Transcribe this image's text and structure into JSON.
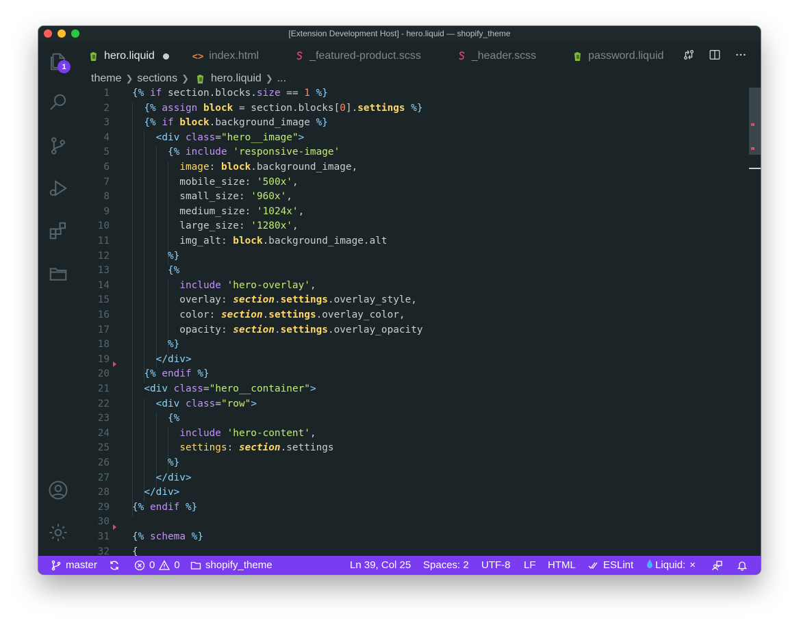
{
  "window": {
    "title": "[Extension Development Host] - hero.liquid — shopify_theme"
  },
  "activity_bar": {
    "badge_count": "1",
    "icons": [
      "files-icon",
      "search-icon",
      "source-control-icon",
      "run-debug-icon",
      "extensions-icon",
      "folder-icon",
      "account-icon",
      "gear-icon"
    ]
  },
  "tabs": [
    {
      "label": "hero.liquid",
      "icon": "shopify-icon",
      "icon_color": "#7fba3a",
      "active": true,
      "modified": true
    },
    {
      "label": "index.html",
      "icon": "html-icon",
      "icon_color": "#e8833a",
      "active": false
    },
    {
      "label": "_featured-product.scss",
      "icon": "sass-icon",
      "icon_color": "#e0456f",
      "active": false
    },
    {
      "label": "_header.scss",
      "icon": "sass-icon",
      "icon_color": "#e0456f",
      "active": false
    },
    {
      "label": "password.liquid",
      "icon": "shopify-icon",
      "icon_color": "#7fba3a",
      "active": false
    }
  ],
  "breadcrumb": {
    "items": [
      "theme",
      "sections",
      "hero.liquid",
      "..."
    ]
  },
  "editor": {
    "line_numbers": [
      "1",
      "2",
      "3",
      "4",
      "5",
      "6",
      "7",
      "8",
      "9",
      "10",
      "11",
      "12",
      "13",
      "14",
      "15",
      "16",
      "17",
      "18",
      "19",
      "20",
      "21",
      "22",
      "23",
      "24",
      "25",
      "26",
      "27",
      "28",
      "29",
      "30",
      "31",
      "32"
    ],
    "lines": [
      [
        [
          "d",
          "{% "
        ],
        [
          "k",
          "if "
        ],
        [
          "p",
          "section.blocks."
        ],
        [
          "k",
          "size"
        ],
        [
          "p",
          " == "
        ],
        [
          "n",
          "1"
        ],
        [
          "d",
          " %}"
        ]
      ],
      [
        [
          "p",
          "  "
        ],
        [
          "d",
          "{% "
        ],
        [
          "k",
          "assign "
        ],
        [
          "v",
          "block"
        ],
        [
          "p",
          " = section.blocks["
        ],
        [
          "n",
          "0"
        ],
        [
          "p",
          "]."
        ],
        [
          "v",
          "settings"
        ],
        [
          "d",
          " %}"
        ]
      ],
      [
        [
          "p",
          "  "
        ],
        [
          "d",
          "{% "
        ],
        [
          "k",
          "if "
        ],
        [
          "v",
          "block"
        ],
        [
          "p",
          ".background_image "
        ],
        [
          "d",
          "%}"
        ]
      ],
      [
        [
          "p",
          "    "
        ],
        [
          "t",
          "<div "
        ],
        [
          "a",
          "class"
        ],
        [
          "p",
          "="
        ],
        [
          "s",
          "\"hero__image\""
        ],
        [
          "t",
          ">"
        ]
      ],
      [
        [
          "p",
          "      "
        ],
        [
          "d",
          "{% "
        ],
        [
          "k",
          "include "
        ],
        [
          "s",
          "'responsive-image'"
        ]
      ],
      [
        [
          "p",
          "        "
        ],
        [
          "prop",
          "image"
        ],
        [
          "p",
          ": "
        ],
        [
          "v",
          "block"
        ],
        [
          "p",
          ".background_image,"
        ]
      ],
      [
        [
          "p",
          "        mobile_size: "
        ],
        [
          "s",
          "'500x'"
        ],
        [
          "p",
          ","
        ]
      ],
      [
        [
          "p",
          "        small_size: "
        ],
        [
          "s",
          "'960x'"
        ],
        [
          "p",
          ","
        ]
      ],
      [
        [
          "p",
          "        medium_size: "
        ],
        [
          "s",
          "'1024x'"
        ],
        [
          "p",
          ","
        ]
      ],
      [
        [
          "p",
          "        large_size: "
        ],
        [
          "s",
          "'1280x'"
        ],
        [
          "p",
          ","
        ]
      ],
      [
        [
          "p",
          "        img_alt: "
        ],
        [
          "v",
          "block"
        ],
        [
          "p",
          ".background_image.alt"
        ]
      ],
      [
        [
          "p",
          "      "
        ],
        [
          "d",
          "%}"
        ]
      ],
      [
        [
          "p",
          "      "
        ],
        [
          "d",
          "{%"
        ]
      ],
      [
        [
          "p",
          "        "
        ],
        [
          "k",
          "include "
        ],
        [
          "s",
          "'hero-overlay'"
        ],
        [
          "p",
          ","
        ]
      ],
      [
        [
          "p",
          "        overlay: "
        ],
        [
          "i",
          "section"
        ],
        [
          "p",
          "."
        ],
        [
          "v",
          "settings"
        ],
        [
          "p",
          ".overlay_style,"
        ]
      ],
      [
        [
          "p",
          "        color: "
        ],
        [
          "i",
          "section"
        ],
        [
          "p",
          "."
        ],
        [
          "v",
          "settings"
        ],
        [
          "p",
          ".overlay_color,"
        ]
      ],
      [
        [
          "p",
          "        opacity: "
        ],
        [
          "i",
          "section"
        ],
        [
          "p",
          "."
        ],
        [
          "v",
          "settings"
        ],
        [
          "p",
          ".overlay_opacity"
        ]
      ],
      [
        [
          "p",
          "      "
        ],
        [
          "d",
          "%}"
        ]
      ],
      [
        [
          "p",
          "    "
        ],
        [
          "t",
          "</div>"
        ]
      ],
      [
        [
          "p",
          "  "
        ],
        [
          "d",
          "{% "
        ],
        [
          "k",
          "endif "
        ],
        [
          "d",
          "%}"
        ]
      ],
      [
        [
          "p",
          "  "
        ],
        [
          "t",
          "<div "
        ],
        [
          "a",
          "class"
        ],
        [
          "p",
          "="
        ],
        [
          "s",
          "\"hero__container\""
        ],
        [
          "t",
          ">"
        ]
      ],
      [
        [
          "p",
          "    "
        ],
        [
          "t",
          "<div "
        ],
        [
          "a",
          "class"
        ],
        [
          "p",
          "="
        ],
        [
          "s",
          "\"row\""
        ],
        [
          "t",
          ">"
        ]
      ],
      [
        [
          "p",
          "      "
        ],
        [
          "d",
          "{%"
        ]
      ],
      [
        [
          "p",
          "        "
        ],
        [
          "k",
          "include "
        ],
        [
          "s",
          "'hero-content'"
        ],
        [
          "p",
          ","
        ]
      ],
      [
        [
          "p",
          "        "
        ],
        [
          "prop",
          "settings"
        ],
        [
          "p",
          ": "
        ],
        [
          "i",
          "section"
        ],
        [
          "p",
          ".settings"
        ]
      ],
      [
        [
          "p",
          "      "
        ],
        [
          "d",
          "%}"
        ]
      ],
      [
        [
          "p",
          "    "
        ],
        [
          "t",
          "</div>"
        ]
      ],
      [
        [
          "p",
          "  "
        ],
        [
          "t",
          "</div>"
        ]
      ],
      [
        [
          "d",
          "{% "
        ],
        [
          "k",
          "endif "
        ],
        [
          "d",
          "%}"
        ]
      ],
      [
        [
          "p",
          ""
        ]
      ],
      [
        [
          "d",
          "{% "
        ],
        [
          "k",
          "schema "
        ],
        [
          "d",
          "%}"
        ]
      ],
      [
        [
          "p",
          "{"
        ]
      ]
    ]
  },
  "status_bar": {
    "branch": "master",
    "errors": "0",
    "warnings": "0",
    "folder": "shopify_theme",
    "position": "Ln 39, Col 25",
    "spaces": "Spaces: 2",
    "encoding": "UTF-8",
    "eol": "LF",
    "language": "HTML",
    "eslint": "ESLint",
    "liquid": "Liquid:",
    "liquid_close": "×"
  },
  "colors": {
    "status_bar_bg": "#7a3cf0",
    "editor_bg": "#1b2528",
    "badge": "#7b3cf0"
  }
}
